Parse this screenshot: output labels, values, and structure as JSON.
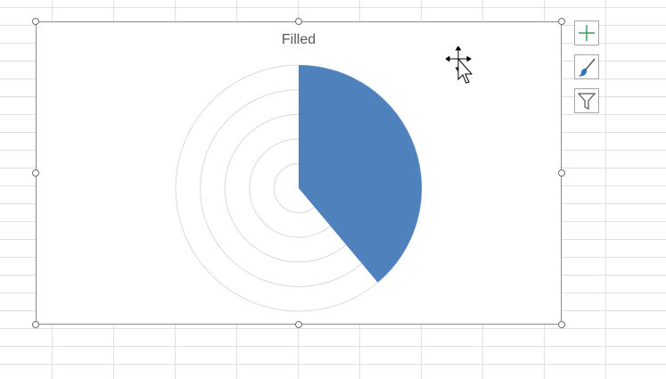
{
  "chart_data": {
    "type": "radar",
    "title": "Filled",
    "style": "filled",
    "grid": true,
    "grid_rings": 5,
    "legend": "none",
    "fill_color": "#4f81bd",
    "sectors": [
      {
        "start_deg": 0,
        "end_deg": 140,
        "value": 1.0
      }
    ]
  },
  "toolbar": {
    "buttons": [
      {
        "name": "chart-elements",
        "icon": "plus-icon"
      },
      {
        "name": "chart-styles",
        "icon": "paintbrush-icon"
      },
      {
        "name": "chart-filters",
        "icon": "funnel-icon"
      }
    ]
  },
  "cursor": {
    "icon": "move-cursor-icon"
  },
  "colors": {
    "accent_green": "#3c9a5f",
    "brush_blue": "#2f74c0",
    "gridline": "#e1e1e1"
  }
}
